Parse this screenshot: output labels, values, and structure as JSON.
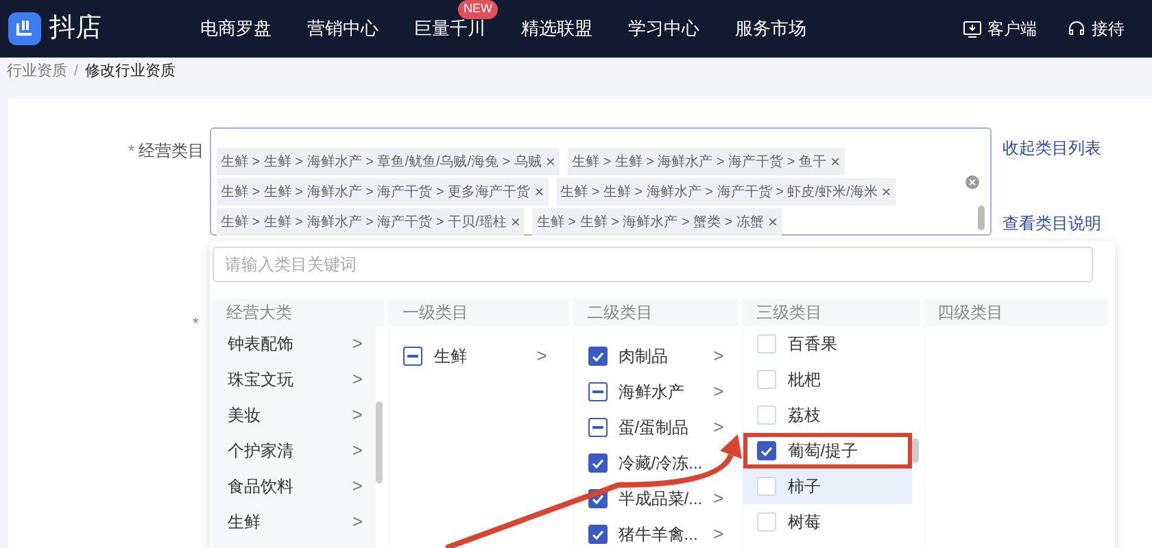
{
  "header": {
    "logo_text": "抖店",
    "nav": [
      {
        "label": "电商罗盘"
      },
      {
        "label": "营销中心"
      },
      {
        "label": "巨量千川",
        "badge": "NEW"
      },
      {
        "label": "精选联盟"
      },
      {
        "label": "学习中心"
      },
      {
        "label": "服务市场"
      }
    ],
    "actions": [
      {
        "kind": "download",
        "label": "客户端"
      },
      {
        "kind": "headset",
        "label": "接待"
      }
    ]
  },
  "breadcrumb": {
    "separator": "/",
    "items": [
      {
        "label": "行业资质",
        "current": false
      },
      {
        "label": "修改行业资质",
        "current": true
      }
    ]
  },
  "form": {
    "required_mark": "*",
    "label": "经营类目",
    "second_required_mark": "*",
    "tags": [
      [
        "生鲜 > 生鲜 > 海鲜水产 > 章鱼/鱿鱼/乌贼/海兔 > 乌贼",
        "生鲜 > 生鲜 > 海鲜水产 > 海产干货 > 鱼干"
      ],
      [
        "生鲜 > 生鲜 > 海鲜水产 > 海产干货 > 更多海产干货",
        "生鲜 > 生鲜 > 海鲜水产 > 海产干货 > 虾皮/虾米/海米"
      ],
      [
        "生鲜 > 生鲜 > 海鲜水产 > 海产干货 > 干贝/瑶柱",
        "生鲜 > 生鲜 > 海鲜水产 > 蟹类 > 冻蟹"
      ]
    ],
    "tag_close": "×",
    "links": [
      "收起类目列表",
      "查看类目说明"
    ],
    "search_placeholder": "请输入类目关键词"
  },
  "columns": [
    {
      "title": "经营大类",
      "items": [
        {
          "label": "钟表配饰",
          "arrow": ">"
        },
        {
          "label": "珠宝文玩",
          "arrow": ">"
        },
        {
          "label": "美妆",
          "arrow": ">"
        },
        {
          "label": "个护家清",
          "arrow": ">"
        },
        {
          "label": "食品饮料",
          "arrow": ">"
        },
        {
          "label": "生鲜",
          "arrow": ">"
        }
      ]
    },
    {
      "title": "一级类目",
      "items": [
        {
          "label": "生鲜",
          "checked": false,
          "indeterminate": true,
          "arrow": ">"
        }
      ]
    },
    {
      "title": "二级类目",
      "items": [
        {
          "label": "肉制品",
          "checked": true,
          "indeterminate": false,
          "arrow": ">"
        },
        {
          "label": "海鲜水产",
          "checked": false,
          "indeterminate": true,
          "arrow": ">"
        },
        {
          "label": "蛋/蛋制品",
          "checked": false,
          "indeterminate": true,
          "arrow": ">"
        },
        {
          "label": "冷藏/冷冻...",
          "checked": true,
          "indeterminate": false
        },
        {
          "label": "半成品菜/...",
          "checked": true,
          "indeterminate": false,
          "arrow": ">"
        },
        {
          "label": "猪牛羊禽...",
          "checked": true,
          "indeterminate": false,
          "arrow": ">"
        }
      ]
    },
    {
      "title": "三级类目",
      "items": [
        {
          "label": "百香果",
          "checked": false,
          "indeterminate": false,
          "highlighted": false
        },
        {
          "label": "枇杷",
          "checked": false,
          "indeterminate": false,
          "highlighted": false
        },
        {
          "label": "荔枝",
          "checked": false,
          "indeterminate": false,
          "highlighted": false
        },
        {
          "label": "葡萄/提子",
          "checked": true,
          "indeterminate": false,
          "highlighted": false
        },
        {
          "label": "柿子",
          "checked": false,
          "indeterminate": false,
          "highlighted": true
        },
        {
          "label": "树莓",
          "checked": false,
          "indeterminate": false,
          "highlighted": false
        }
      ]
    },
    {
      "title": "四级类目"
    }
  ]
}
